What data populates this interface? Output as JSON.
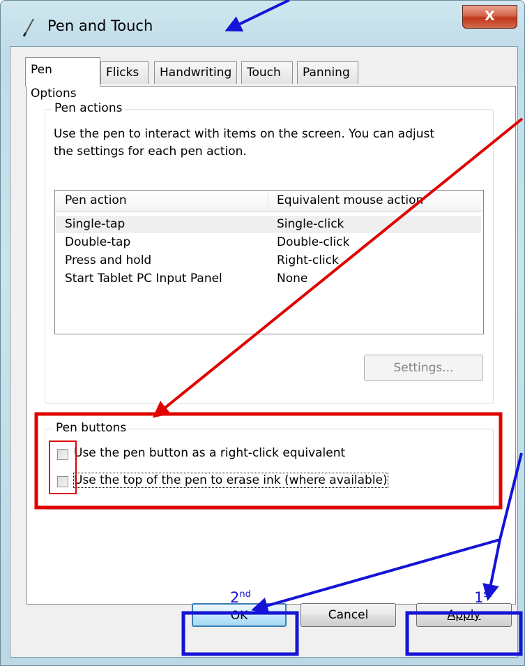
{
  "window": {
    "title": "Pen and Touch",
    "close_glyph": "X"
  },
  "tabs": [
    {
      "label": "Pen Options"
    },
    {
      "label": "Flicks"
    },
    {
      "label": "Handwriting"
    },
    {
      "label": "Touch"
    },
    {
      "label": "Panning"
    }
  ],
  "pen_actions": {
    "group_label": "Pen actions",
    "desc_line1": "Use the pen to interact with items on the screen.  You can adjust",
    "desc_line2": "the settings for each pen action.",
    "columns": [
      "Pen action",
      "Equivalent mouse action"
    ],
    "rows": [
      {
        "action": "Single-tap",
        "mouse": "Single-click"
      },
      {
        "action": "Double-tap",
        "mouse": "Double-click"
      },
      {
        "action": "Press and hold",
        "mouse": "Right-click"
      },
      {
        "action": "Start Tablet PC Input Panel",
        "mouse": "None"
      }
    ],
    "settings_button": "Settings..."
  },
  "pen_buttons": {
    "group_label": "Pen buttons",
    "option1": "Use the pen button as a right-click equivalent",
    "option2": "Use the top of the pen to erase ink (where available)",
    "option1_checked": false,
    "option2_checked": false
  },
  "buttons": {
    "ok": "OK",
    "cancel": "Cancel",
    "apply": "Apply"
  },
  "annotations": {
    "ok_order": "2",
    "ok_order_suffix": "nd",
    "apply_order": "1",
    "apply_order_suffix": "st",
    "arrow_color_blue": "#1414d6",
    "arrow_color_red": "#e00000"
  }
}
